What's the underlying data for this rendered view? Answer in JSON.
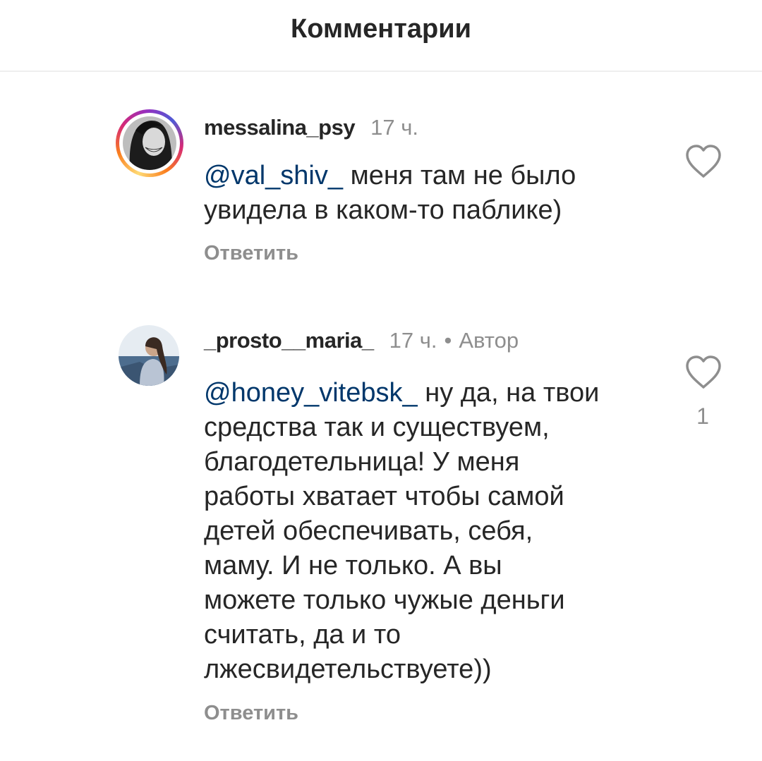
{
  "header": {
    "title": "Комментарии"
  },
  "comments": [
    {
      "username": "messalina_psy",
      "time": "17 ч.",
      "mention": "@val_shiv_",
      "text_lines": [
        "меня там не было",
        "увидела в каком-то паблике)"
      ],
      "reply_label": "Ответить",
      "like_icon": "heart-outline-icon",
      "has_story_ring": true
    },
    {
      "username": "_prosto__maria_",
      "time": "17 ч.",
      "separator": "•",
      "author_badge": "Автор",
      "mention": "@honey_vitebsk_",
      "text_lines": [
        "ну да, на твои",
        "средства так и существуем,",
        "благодетельница! У меня",
        "работы хватает чтобы самой",
        "детей обеспечивать, себя,",
        "маму. И не только. А вы",
        "можете только чужые деньги",
        "считать, да и то",
        "лжесвидетельствуете))"
      ],
      "reply_label": "Ответить",
      "like_icon": "heart-outline-icon",
      "like_count": "1"
    }
  ],
  "colors": {
    "mention": "#00376b",
    "secondary_text": "#8e8e8e",
    "primary_text": "#262626"
  }
}
